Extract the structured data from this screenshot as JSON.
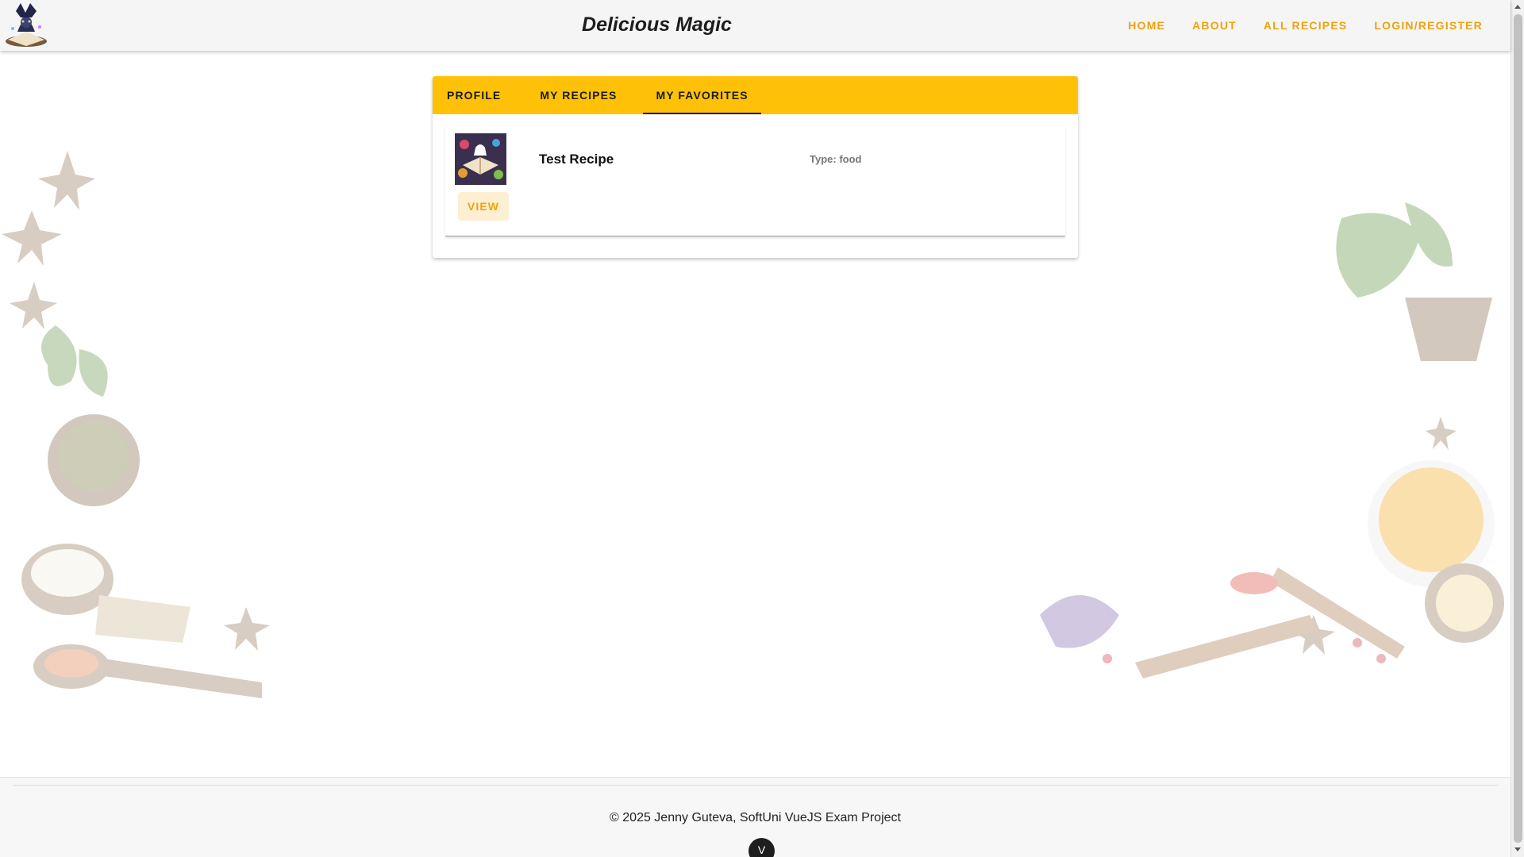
{
  "header": {
    "title": "Delicious Magic",
    "logo_icon": "wizard-book-logo",
    "nav": [
      {
        "label": "HOME"
      },
      {
        "label": "ABOUT"
      },
      {
        "label": "ALL RECIPES"
      },
      {
        "label": "LOGIN/REGISTER"
      }
    ]
  },
  "profile": {
    "tabs": [
      {
        "label": "PROFILE",
        "active": false
      },
      {
        "label": "MY RECIPES",
        "active": false
      },
      {
        "label": "MY FAVORITES",
        "active": true
      }
    ],
    "favorites": [
      {
        "name": "Test Recipe",
        "type_text": "Type: food",
        "view_label": "VIEW",
        "thumbnail_icon": "recipe-book-image"
      }
    ]
  },
  "footer": {
    "text": "© 2025 Jenny Guteva, SoftUni VueJS Exam Project",
    "fab_icon": "chevron-down-icon",
    "fab_glyph": "V"
  },
  "colors": {
    "accent": "#f0a20b",
    "tab_bar": "#fec107",
    "header_bg": "#f5f5f5"
  }
}
